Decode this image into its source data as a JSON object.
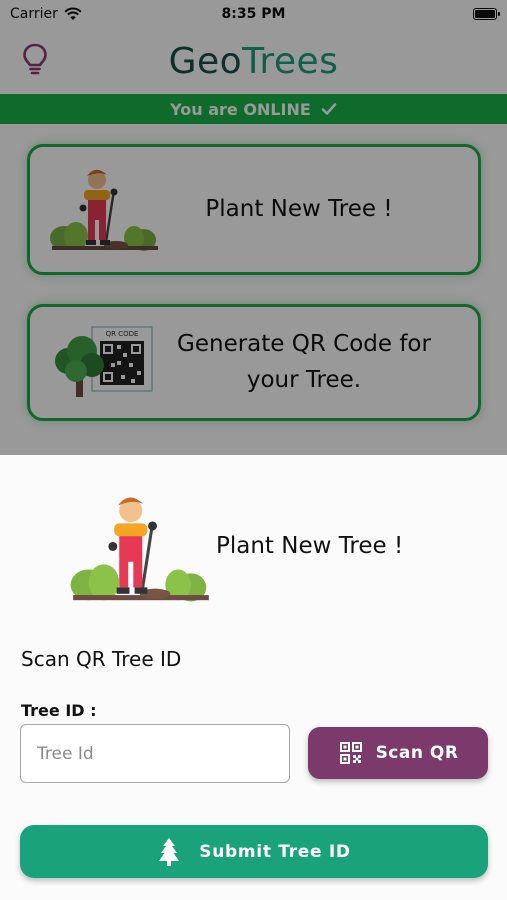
{
  "status_bar": {
    "carrier": "Carrier",
    "time": "8:35 PM",
    "icons": [
      "wifi-icon",
      "battery-icon"
    ]
  },
  "header": {
    "title_part1": "Geo",
    "title_part2": "Trees",
    "left_icon": "lightbulb-icon"
  },
  "connection": {
    "text": "You are ONLINE",
    "icon": "check-icon"
  },
  "menu": {
    "plant_card": {
      "label": "Plant New Tree !",
      "image": "gardener-illustration"
    },
    "qr_card": {
      "label_line1": "Generate QR Code for",
      "label_line2": "your Tree.",
      "image": "tree-qr-illustration",
      "qr_caption": "QR CODE"
    }
  },
  "sheet": {
    "heading": "Plant New Tree !",
    "section_title": "Scan QR Tree ID",
    "field_label": "Tree ID :",
    "input_placeholder": "Tree Id",
    "scan_button": "Scan QR",
    "submit_button": "Submit Tree ID"
  },
  "colors": {
    "online_green": "#1ab34a",
    "brand_dark": "#17504a",
    "brand_teal": "#19a07c",
    "scan_purple": "#7b3a6b",
    "submit_green": "#1aa37a"
  }
}
